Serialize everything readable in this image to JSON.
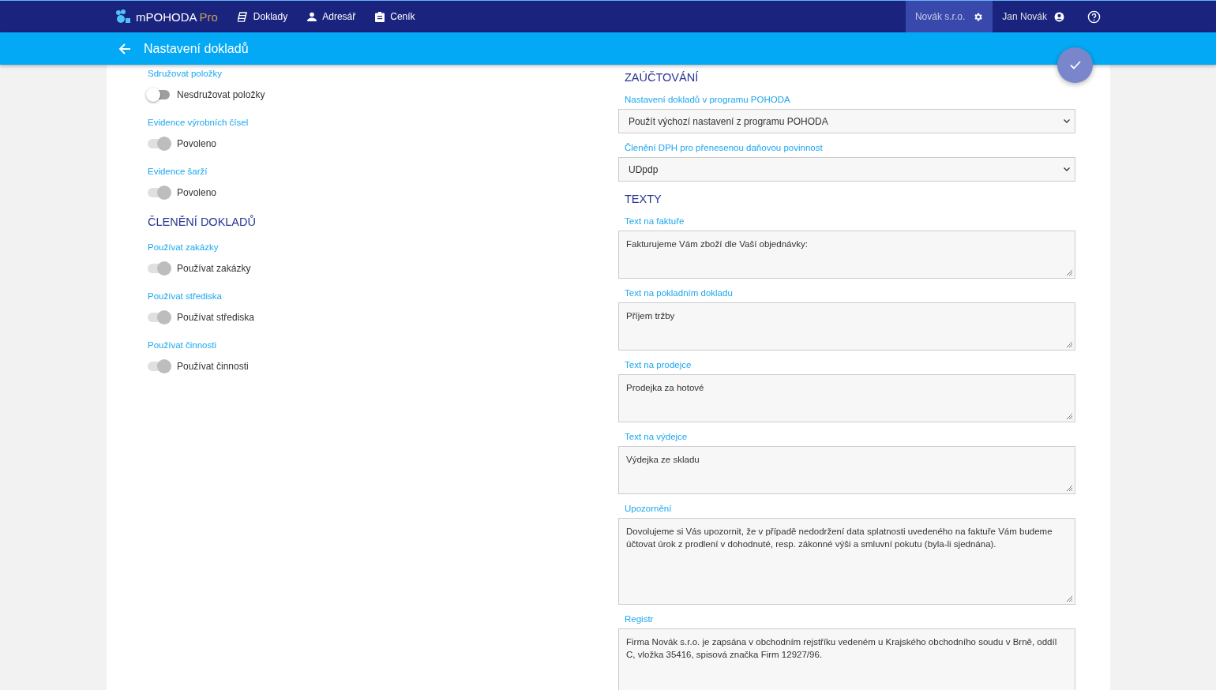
{
  "nav": {
    "brand": "mPOHODA",
    "brand_suffix": "Pro",
    "items": [
      {
        "label": "Doklady"
      },
      {
        "label": "Adresář"
      },
      {
        "label": "Ceník"
      }
    ],
    "company": "Novák s.r.o.",
    "user": "Jan Novák"
  },
  "header": {
    "title": "Nastavení dokladů"
  },
  "left": [
    {
      "kind": "toggle",
      "label": "Sdružovat položky",
      "text": "Nesdružovat položky",
      "on": false,
      "disabled": false
    },
    {
      "kind": "toggle",
      "label": "Evidence výrobních čísel",
      "text": "Povoleno",
      "on": true,
      "disabled": true
    },
    {
      "kind": "toggle",
      "label": "Evidence šarží",
      "text": "Povoleno",
      "on": true,
      "disabled": true
    },
    {
      "kind": "heading",
      "text": "ČLENĚNÍ DOKLADŮ"
    },
    {
      "kind": "toggle",
      "label": "Používat zakázky",
      "text": "Používat zakázky",
      "on": true,
      "disabled": true
    },
    {
      "kind": "toggle",
      "label": "Používat střediska",
      "text": "Používat střediska",
      "on": true,
      "disabled": true
    },
    {
      "kind": "toggle",
      "label": "Používat činnosti",
      "text": "Používat činnosti",
      "on": true,
      "disabled": true
    }
  ],
  "right": [
    {
      "kind": "heading",
      "text": "ZAÚČTOVÁNÍ"
    },
    {
      "kind": "select",
      "label": "Nastavení dokladů v programu POHODA",
      "value": "Použít výchozí nastavení z programu POHODA"
    },
    {
      "kind": "select",
      "label": "Členění DPH pro přenesenou daňovou povinnost",
      "value": "UDpdp"
    },
    {
      "kind": "heading",
      "text": "TEXTY"
    },
    {
      "kind": "textarea",
      "label": "Text na faktuře",
      "value": "Fakturujeme Vám zboží dle Vaší objednávky:"
    },
    {
      "kind": "textarea",
      "label": "Text na pokladním dokladu",
      "value": "Příjem tržby"
    },
    {
      "kind": "textarea",
      "label": "Text na prodejce",
      "value": "Prodejka za hotové"
    },
    {
      "kind": "textarea",
      "label": "Text na výdejce",
      "value": "Výdejka ze skladu"
    },
    {
      "kind": "textarea",
      "label": "Upozornění",
      "value": "Dovolujeme si Vás upozornit, že v případě nedodržení data splatnosti uvedeného na faktuře Vám budeme účtovat úrok z prodlení v dohodnuté, resp. zákonné výši a smluvní pokutu (byla-li sjednána)."
    },
    {
      "kind": "textarea",
      "label": "Registr",
      "value": "Firma Novák s.r.o. je zapsána v obchodním rejstříku vedeném u Krajského obchodního soudu v Brně, oddíl C, vložka 35416, spisová značka Firm 12927/96."
    }
  ]
}
